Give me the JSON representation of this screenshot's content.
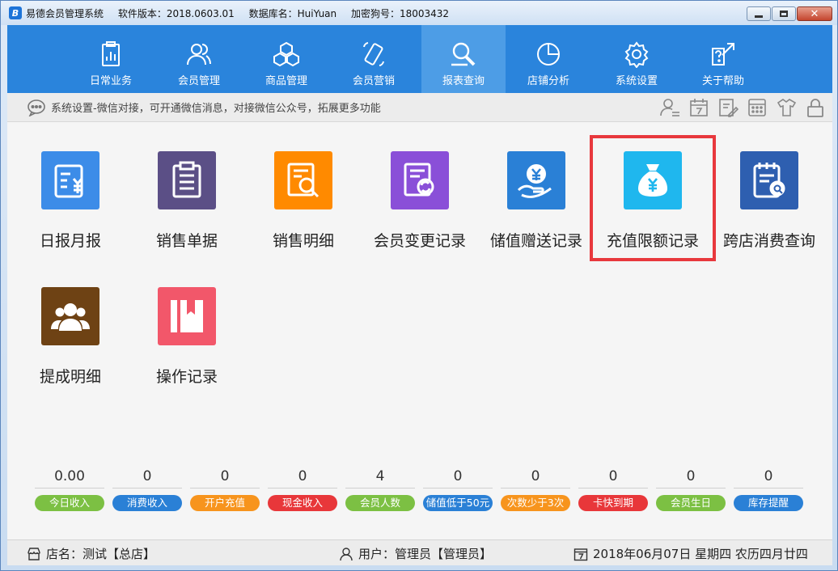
{
  "titlebar": {
    "app_name": "易德会员管理系统",
    "version": "软件版本：2018.0603.01",
    "database": "数据库名：HuiYuan",
    "dongle": "加密狗号：18003432"
  },
  "nav": {
    "items": [
      {
        "label": "日常业务",
        "icon": "clipboard-chart-icon"
      },
      {
        "label": "会员管理",
        "icon": "users-icon"
      },
      {
        "label": "商品管理",
        "icon": "boxes-icon"
      },
      {
        "label": "会员营销",
        "icon": "phone-icon"
      },
      {
        "label": "报表查询",
        "icon": "report-search-icon"
      },
      {
        "label": "店铺分析",
        "icon": "pie-chart-icon"
      },
      {
        "label": "系统设置",
        "icon": "gear-icon"
      },
      {
        "label": "关于帮助",
        "icon": "help-icon"
      }
    ],
    "active": "报表查询"
  },
  "notice": {
    "text": "系统设置-微信对接，可开通微信消息，对接微信公众号，拓展更多功能"
  },
  "tiles": [
    {
      "label": "日报月报",
      "color": "#3c8ce8"
    },
    {
      "label": "销售单据",
      "color": "#5b4f86"
    },
    {
      "label": "销售明细",
      "color": "#ff8a00"
    },
    {
      "label": "会员变更记录",
      "color": "#8a4fd8"
    },
    {
      "label": "储值赠送记录",
      "color": "#2a80d6"
    },
    {
      "label": "充值限额记录",
      "color": "#1fb7ee"
    },
    {
      "label": "跨店消费查询",
      "color": "#2e5fb0"
    },
    {
      "label": "提成明细",
      "color": "#6e4214"
    },
    {
      "label": "操作记录",
      "color": "#f2576a"
    }
  ],
  "stats": [
    {
      "value": "0.00",
      "label": "今日收入",
      "color": "#7cc043"
    },
    {
      "value": "0",
      "label": "消费收入",
      "color": "#2a80d6"
    },
    {
      "value": "0",
      "label": "开户充值",
      "color": "#f7941d"
    },
    {
      "value": "0",
      "label": "现金收入",
      "color": "#e8373a"
    },
    {
      "value": "4",
      "label": "会员人数",
      "color": "#7cc043"
    },
    {
      "value": "0",
      "label": "储值低于50元",
      "color": "#2a80d6"
    },
    {
      "value": "0",
      "label": "次数少于3次",
      "color": "#f7941d"
    },
    {
      "value": "0",
      "label": "卡快到期",
      "color": "#e8373a"
    },
    {
      "value": "0",
      "label": "会员生日",
      "color": "#7cc043"
    },
    {
      "value": "0",
      "label": "库存提醒",
      "color": "#2a80d6"
    }
  ],
  "statusbar": {
    "store": "店名：测试【总店】",
    "user": "用户：管理员【管理员】",
    "date": "2018年06月07日 星期四 农历四月廿四"
  }
}
